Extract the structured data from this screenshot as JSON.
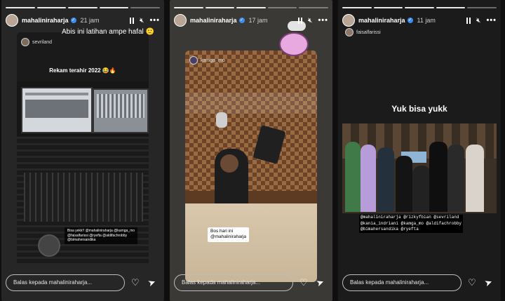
{
  "stories": [
    {
      "username": "mahaliniraharja",
      "time": "21 jam",
      "caption": "Abis ini latihan ampe hafal",
      "caption_emoji": "🙂",
      "shared_user": "sevriland",
      "shared_text": "Rekam terahir 2022 😂🔥",
      "tags": [
        "Bisa yekk!! @mahaliniraharja @kamga_mo",
        "@faisalfarissi @ryefta @aldifachrobby",
        "@bimahersandika"
      ],
      "reply_placeholder": "Balas kepada mahaliniraharja..."
    },
    {
      "username": "mahaliniraharja",
      "time": "17 jam",
      "shared_user": "kamga_mo",
      "tag_title": "Bos hari ini",
      "tag_mention": "@mahaliniraharja",
      "reply_placeholder": "Balas kepada mahaliniraharja..."
    },
    {
      "username": "mahaliniraharja",
      "time": "11 jam",
      "shared_user": "faisalfarissi",
      "shared_text": "Yuk bisa yukk",
      "tags": [
        "@mahaliniraharja @rizkyfbian @sevriland",
        "@kania_indriani @kamga_mo @aldifachrobby",
        "@bimahersandika @ryefta"
      ],
      "reply_placeholder": "Balas kepada mahaliniraharja..."
    }
  ],
  "colors": {
    "verified": "#3d8df5",
    "studio_wood": "#8a5a34",
    "panel_dark": "#1c1c1c"
  },
  "icons": [
    "pause-icon",
    "mute-icon",
    "more-icon",
    "heart-icon",
    "send-icon",
    "verified-icon"
  ]
}
